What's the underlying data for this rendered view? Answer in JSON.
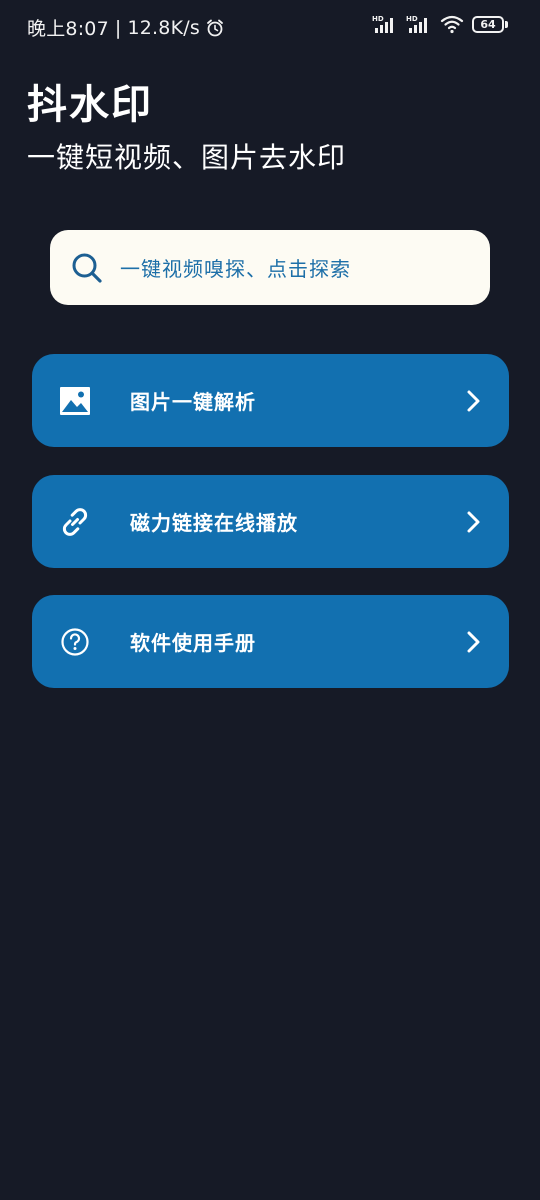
{
  "status_bar": {
    "time": "晚上8:07",
    "separator": "|",
    "network_speed": "12.8K/s",
    "battery_level": "64",
    "icons": [
      "alarm-icon",
      "hd-signal-icon",
      "hd-signal-icon",
      "wifi-icon",
      "battery-icon"
    ]
  },
  "header": {
    "title": "抖水印",
    "subtitle": "一键短视频、图片去水印"
  },
  "search": {
    "placeholder": "一键视频嗅探、点击探索",
    "icon": "search-icon"
  },
  "menu": [
    {
      "label": "图片一键解析",
      "icon": "image-icon"
    },
    {
      "label": "磁力链接在线播放",
      "icon": "link-icon"
    },
    {
      "label": "软件使用手册",
      "icon": "help-icon"
    }
  ],
  "colors": {
    "background": "#161a26",
    "card": "#1270b0",
    "search_bg": "#fdfbf3",
    "search_text": "#1d6fa8"
  }
}
